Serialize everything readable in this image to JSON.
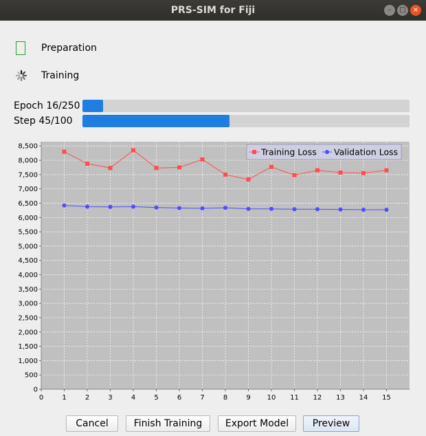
{
  "window": {
    "title": "PRS-SIM for Fiji",
    "controls": {
      "minimize": "–",
      "maximize": "□",
      "close": "×"
    }
  },
  "status": {
    "preparation": "Preparation",
    "training": "Training"
  },
  "progress": {
    "epoch": {
      "label": "Epoch 16/250",
      "fraction": 0.064
    },
    "step": {
      "label": "Step 45/100",
      "fraction": 0.45
    }
  },
  "chart_data": {
    "type": "line",
    "x": [
      1,
      2,
      3,
      4,
      5,
      6,
      7,
      8,
      9,
      10,
      11,
      12,
      13,
      14,
      15
    ],
    "xlim": [
      0,
      16
    ],
    "ylim": [
      0,
      8650
    ],
    "xticks": [
      0,
      1,
      2,
      3,
      4,
      5,
      6,
      7,
      8,
      9,
      10,
      11,
      12,
      13,
      14,
      15
    ],
    "yticks": [
      0,
      500,
      1000,
      1500,
      2000,
      2500,
      3000,
      3500,
      4000,
      4500,
      5000,
      5500,
      6000,
      6500,
      7000,
      7500,
      8000,
      8500
    ],
    "ytick_labels": [
      "0",
      "500",
      "1,000",
      "1,500",
      "2,000",
      "2,500",
      "3,000",
      "3,500",
      "4,000",
      "4,500",
      "5,000",
      "5,500",
      "6,000",
      "6,500",
      "7,000",
      "7,500",
      "8,000",
      "8,500"
    ],
    "grid": true,
    "legend": "top-right",
    "background": "#c0c0c0",
    "series": [
      {
        "name": "Training Loss",
        "color": "#ff4d4d",
        "marker": "square",
        "values": [
          8300,
          7880,
          7730,
          8350,
          7730,
          7750,
          8030,
          7500,
          7330,
          7770,
          7480,
          7650,
          7570,
          7550,
          7650
        ]
      },
      {
        "name": "Validation Loss",
        "color": "#4d4dff",
        "marker": "circle",
        "values": [
          6420,
          6380,
          6370,
          6380,
          6350,
          6330,
          6320,
          6340,
          6300,
          6300,
          6290,
          6290,
          6280,
          6270,
          6270
        ]
      }
    ]
  },
  "buttons": {
    "cancel": "Cancel",
    "finish": "Finish Training",
    "export": "Export Model",
    "preview": "Preview"
  }
}
